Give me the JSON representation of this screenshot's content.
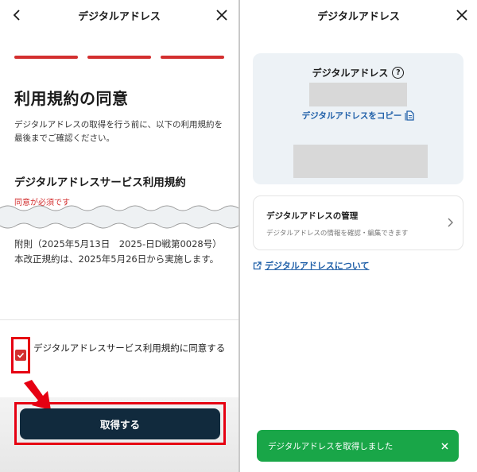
{
  "left_screen": {
    "header_title": "デジタルアドレス",
    "progress_steps": 3,
    "heading": "利用規約の同意",
    "description": "デジタルアドレスの取得を行う前に、以下の利用規約を最後までご確認ください。",
    "terms_title": "デジタルアドレスサービス利用規約",
    "required_label": "同意が必須です",
    "terms_excerpt_line1": "附則（2025年5月13日　2025-日D戦第0028号）",
    "terms_excerpt_line2": "本改正規約は、2025年5月26日から実施します。",
    "agree_label": "デジタルアドレスサービス利用規約に同意する",
    "submit_button": "取得する"
  },
  "right_screen": {
    "header_title": "デジタルアドレス",
    "card_title": "デジタルアドレス",
    "copy_link": "デジタルアドレスをコピー",
    "manage_title": "デジタルアドレスの管理",
    "manage_subtitle": "デジタルアドレスの情報を確認・編集できます",
    "about_link": "デジタルアドレスについて",
    "toast_message": "デジタルアドレスを取得しました"
  },
  "colors": {
    "accent_red": "#d32f2f",
    "highlight_red": "#e60012",
    "primary_button": "#112a3d",
    "link_blue": "#1f5fa8",
    "toast_green": "#19a648",
    "card_bg": "#edf2f6"
  },
  "icons": [
    "back-arrow-icon",
    "close-icon",
    "help-icon",
    "copy-icon",
    "chevron-right-icon",
    "external-link-icon",
    "checkmark-icon"
  ]
}
